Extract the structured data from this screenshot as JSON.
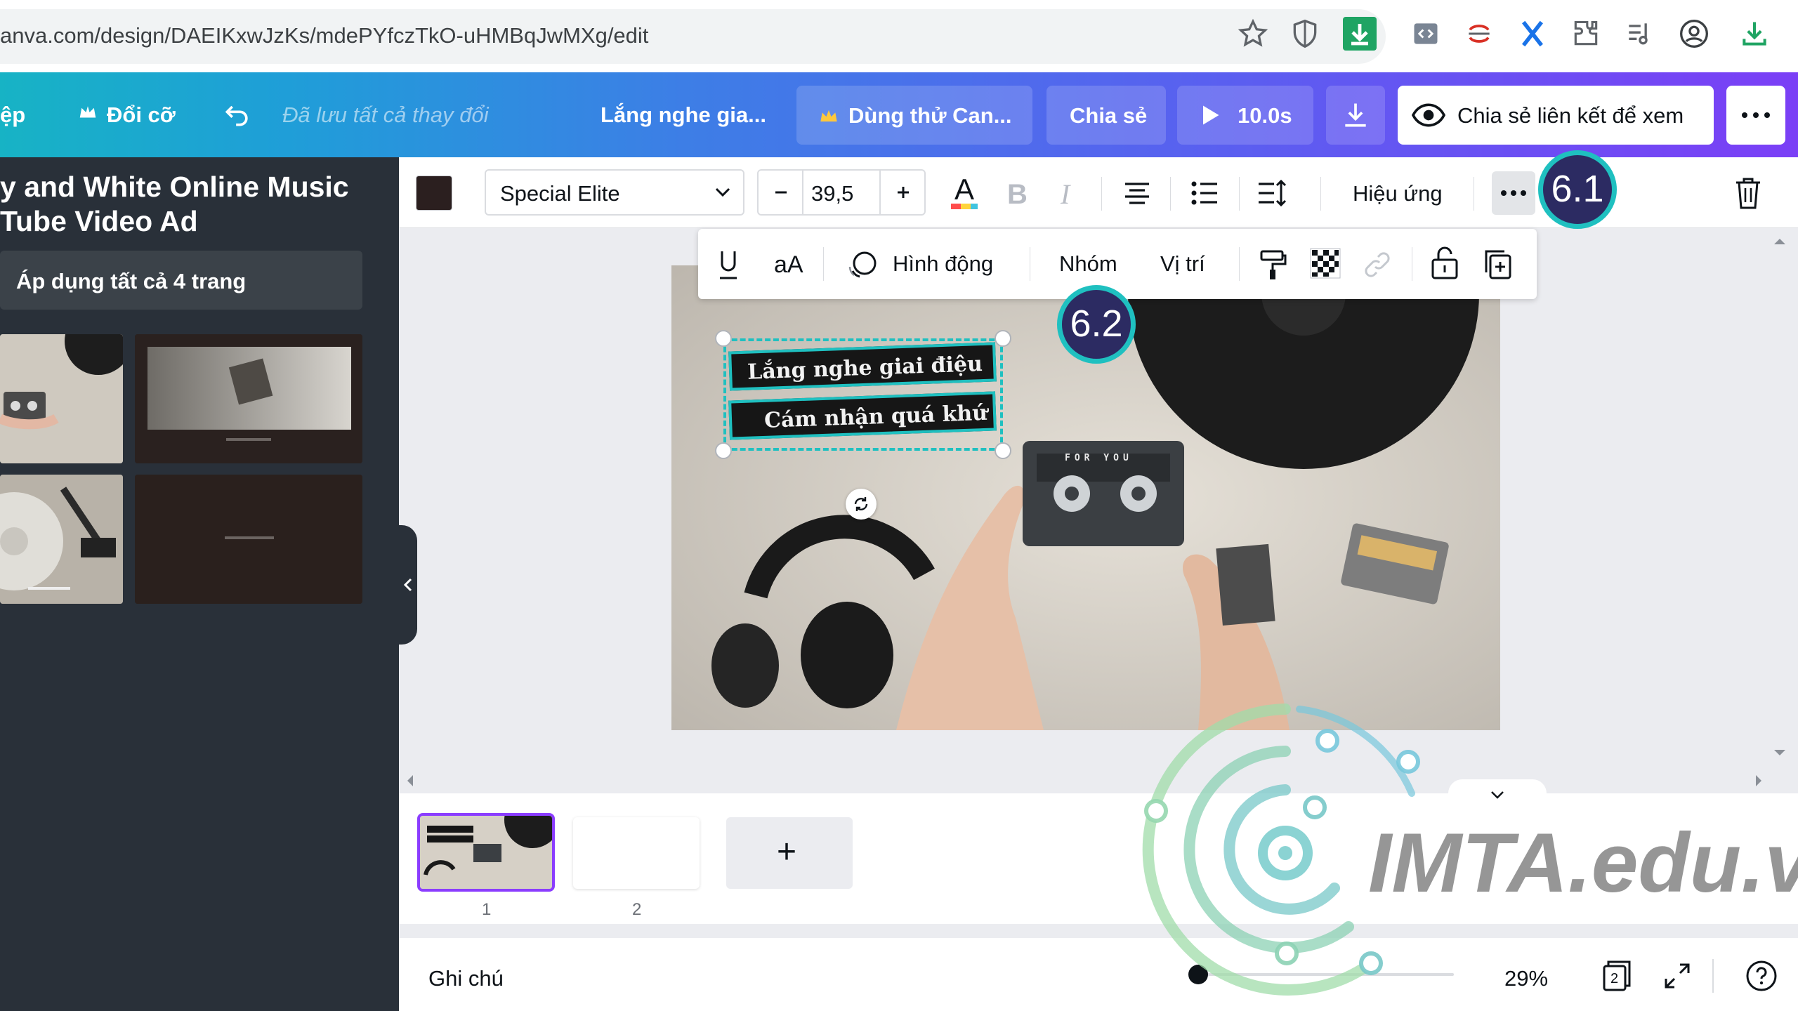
{
  "browser": {
    "url": "anva.com/design/DAEIKxwJzKs/mdePYfczTkO-uHMBqJwMXg/edit"
  },
  "header": {
    "back_partial": "ệp",
    "resize_label": "Đổi cỡ",
    "saved_status": "Đã lưu tất cả thay đổi",
    "design_title": "Lắng nghe gia...",
    "trial_label": "Dùng thử Can...",
    "share_label": "Chia sẻ",
    "play_label": "10.0s",
    "share_link_label": "Chia sẻ liên kết để xem"
  },
  "side_panel": {
    "template_title": "y and White Online Music\nTube Video Ad",
    "apply_all_label": "Áp dụng tất cả 4 trang"
  },
  "toolbar": {
    "font_name": "Special Elite",
    "font_size": "39,5",
    "effects_label": "Hiệu ứng",
    "text_color": "#2b1f1f"
  },
  "sub_toolbar": {
    "case_label": "aA",
    "animate_label": "Hình động",
    "group_label": "Nhóm",
    "position_label": "Vị trí"
  },
  "canvas": {
    "text_line_1": "Lắng nghe giai điệu",
    "text_line_2": "Cám nhận quá khứ",
    "cassette_label": "FOR YOU"
  },
  "annotations": {
    "badge_1": "6.1",
    "badge_2": "6.2"
  },
  "pages": {
    "page_1_number": "1",
    "page_2_number": "2",
    "add_page": "+"
  },
  "bottom_bar": {
    "notes_label": "Ghi chú",
    "zoom": "29%",
    "page_count": "2"
  },
  "watermark": {
    "text": "IMTA.edu.vn"
  },
  "colors": {
    "header_gradient_start": "#17b3c5",
    "header_gradient_end": "#7b3ff6",
    "panel_bg": "#293039",
    "badge_fill": "#2c2b62",
    "badge_ring": "#1fc0c0",
    "selection": "#1fc0c0"
  }
}
